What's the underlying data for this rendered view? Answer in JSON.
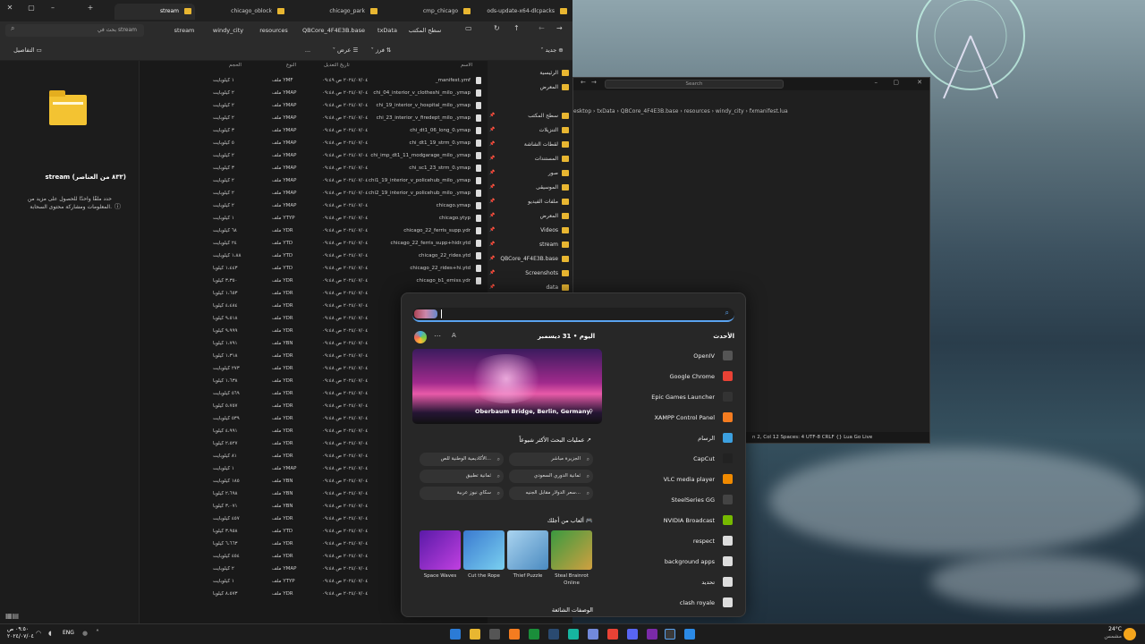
{
  "explorer": {
    "tabs": [
      {
        "label": "stream"
      },
      {
        "label": "chicago_oblock"
      },
      {
        "label": "chicago_park"
      },
      {
        "label": "cmp_chicago"
      },
      {
        "label": "ods-update-x64-dlcpacks"
      }
    ],
    "search_placeholder": "بحث في stream",
    "breadcrumbs": [
      "سطح المكتب",
      "txData",
      "QBCore_4F4E3B.base",
      "resources",
      "windy_city",
      "stream"
    ],
    "toolbar": {
      "new": "جديد",
      "sort": "فرز",
      "view": "عرض",
      "more": "...",
      "details": "التفاصيل"
    },
    "columns": {
      "name": "الاسم",
      "date": "تاريخ التعديل",
      "type": "النوع",
      "size": "الحجم"
    },
    "details_pane": {
      "title": "stream (٨٣٣ من العناصر)",
      "hint": "حدد ملفًا واحدًا للحصول على مزيد من المعلومات ومشاركة محتوى السحابة."
    },
    "nav": [
      "الرئيسية",
      "المعرض",
      "سطح المكتب",
      "التنزيلات",
      "لقطات الشاشة",
      "المستندات",
      "صور",
      "الموسيقى",
      "ملفات الفيديو",
      "المعرض",
      "Videos",
      "stream",
      "QBCore_4F4E3B.base",
      "Screenshots",
      "data"
    ],
    "files": [
      {
        "name": "_manifest.ymf",
        "date": "٢٠٢٤/٠٧/٠٤ ص ٠٩:٤٩",
        "type": "ملف YMF",
        "size": "١ كيلوبايت"
      },
      {
        "name": "chi_04_interior_v_clotheshi_milo_.ymap",
        "date": "٢٠٢٤/٠٧/٠٤ ص ٠٩:٤٨",
        "type": "ملف YMAP",
        "size": "٢ كيلوبايت"
      },
      {
        "name": "chi_19_interior_v_hospital_milo_.ymap",
        "date": "٢٠٢٤/٠٧/٠٤ ص ٠٩:٤٨",
        "type": "ملف YMAP",
        "size": "٢ كيلوبايت"
      },
      {
        "name": "chi_23_interior_v_firedept_milo_.ymap",
        "date": "٢٠٢٤/٠٧/٠٤ ص ٠٩:٤٨",
        "type": "ملف YMAP",
        "size": "٢ كيلوبايت"
      },
      {
        "name": "chi_dt1_06_long_0.ymap",
        "date": "٢٠٢٤/٠٧/٠٤ ص ٠٩:٤٨",
        "type": "ملف YMAP",
        "size": "٣ كيلوبايت"
      },
      {
        "name": "chi_dt1_19_strm_0.ymap",
        "date": "٢٠٢٤/٠٧/٠٤ ص ٠٩:٤٨",
        "type": "ملف YMAP",
        "size": "٥ كيلوبايت"
      },
      {
        "name": "chi_imp_dt1_11_modgarage_milo_.ymap",
        "date": "٢٠٢٤/٠٧/٠٤ ص ٠٩:٤٨",
        "type": "ملف YMAP",
        "size": "٢ كيلوبايت"
      },
      {
        "name": "chi_sc1_23_strm_0.ymap",
        "date": "٢٠٢٤/٠٧/٠٤ ص ٠٩:٤٨",
        "type": "ملف YMAP",
        "size": "٣ كيلوبايت"
      },
      {
        "name": "chi1_19_interior_v_policehub_milo_.ymap",
        "date": "٢٠٢٤/٠٧/٠٤ ص ٠٩:٤٨",
        "type": "ملف YMAP",
        "size": "٢ كيلوبايت"
      },
      {
        "name": "chi2_19_interior_v_policehub_milo_.ymap",
        "date": "٢٠٢٤/٠٧/٠٤ ص ٠٩:٤٨",
        "type": "ملف YMAP",
        "size": "٢ كيلوبايت"
      },
      {
        "name": "chicago.ymap",
        "date": "٢٠٢٤/٠٧/٠٤ ص ٠٩:٤٨",
        "type": "ملف YMAP",
        "size": "٢ كيلوبايت"
      },
      {
        "name": "chicago.ytyp",
        "date": "٢٠٢٤/٠٧/٠٤ ص ٠٩:٤٨",
        "type": "ملف YTYP",
        "size": "١ كيلوبايت"
      },
      {
        "name": "chicago_22_ferris_supp.ydr",
        "date": "٢٠٢٤/٠٧/٠٤ ص ٠٩:٤٨",
        "type": "ملف YDR",
        "size": "٦٨ كيلوبايت"
      },
      {
        "name": "chicago_22_ferris_supp+hidr.ytd",
        "date": "٢٠٢٤/٠٧/٠٤ ص ٠٩:٤٨",
        "type": "ملف YTD",
        "size": "٢٤ كيلوبايت"
      },
      {
        "name": "chicago_22_rides.ytd",
        "date": "٢٠٢٤/٠٧/٠٤ ص ٠٩:٤٨",
        "type": "ملف YTD",
        "size": "١،٨٨ كيلوبايت"
      },
      {
        "name": "chicago_22_rides+hi.ytd",
        "date": "٢٠٢٤/٠٧/٠٤ ص ٠٩:٤٨",
        "type": "ملف YTD",
        "size": "١،٤٤٣ كيلوبا"
      },
      {
        "name": "chicago_b1_emiss.ydr",
        "date": "٢٠٢٤/٠٧/٠٤ ص ٠٩:٤٨",
        "type": "ملف YDR",
        "size": "٣،٣٥٠ كيلوبا"
      },
      {
        "name": "",
        "date": "٢٠٢٤/٠٧/٠٤ ص ٠٩:٤٨",
        "type": "ملف YDR",
        "size": "١،٦٥٣ كيلوبا"
      },
      {
        "name": "",
        "date": "٢٠٢٤/٠٧/٠٤ ص ٠٩:٤٨",
        "type": "ملف YDR",
        "size": "٤،٤٨٤ كيلوبا"
      },
      {
        "name": "",
        "date": "٢٠٢٤/٠٧/٠٤ ص ٠٩:٤٨",
        "type": "ملف YDR",
        "size": "٩،٥١٨ كيلوبا"
      },
      {
        "name": "",
        "date": "٢٠٢٤/٠٧/٠٤ ص ٠٩:٤٨",
        "type": "ملف YDR",
        "size": "٩،٩٩٩ كيلوبا"
      },
      {
        "name": "",
        "date": "٢٠٢٤/٠٧/٠٤ ص ٠٩:٤٨",
        "type": "ملف YBN",
        "size": "١،٧٩١ كيلوبا"
      },
      {
        "name": "",
        "date": "٢٠٢٤/٠٧/٠٤ ص ٠٩:٤٨",
        "type": "ملف YDR",
        "size": "١،٣١٨ كيلوبا"
      },
      {
        "name": "",
        "date": "٢٠٢٤/٠٧/٠٤ ص ٠٩:٤٨",
        "type": "ملف YDR",
        "size": "٢٧٣ كيلوبايت"
      },
      {
        "name": "",
        "date": "٢٠٢٤/٠٧/٠٤ ص ٠٩:٤٨",
        "type": "ملف YDR",
        "size": "١،٦٣٨ كيلوبا"
      },
      {
        "name": "",
        "date": "٢٠٢٤/٠٧/٠٤ ص ٠٩:٤٨",
        "type": "ملف YDR",
        "size": "٥٦٩ كيلوبايت"
      },
      {
        "name": "",
        "date": "٢٠٢٤/٠٧/٠٤ ص ٠٩:٤٨",
        "type": "ملف YDR",
        "size": "٥،٧٥٧ كيلوبا"
      },
      {
        "name": "",
        "date": "٢٠٢٤/٠٧/٠٤ ص ٠٩:٤٨",
        "type": "ملف YDR",
        "size": "٥٣٩ كيلوبايت"
      },
      {
        "name": "",
        "date": "٢٠٢٤/٠٧/٠٤ ص ٠٩:٤٨",
        "type": "ملف YDR",
        "size": "٤،٩٩١ كيلوبا"
      },
      {
        "name": "",
        "date": "٢٠٢٤/٠٧/٠٤ ص ٠٩:٤٨",
        "type": "ملف YDR",
        "size": "٢،٥٢٧ كيلوبا"
      },
      {
        "name": "",
        "date": "٢٠٢٤/٠٧/٠٤ ص ٠٩:٤٨",
        "type": "ملف YDR",
        "size": "٨١ كيلوبايت"
      },
      {
        "name": "",
        "date": "٢٠٢٤/٠٧/٠٤ ص ٠٩:٤٨",
        "type": "ملف YMAP",
        "size": "١ كيلوبايت"
      },
      {
        "name": "",
        "date": "٢٠٢٤/٠٧/٠٤ ص ٠٩:٤٨",
        "type": "ملف YBN",
        "size": "١٨٥ كيلوبايت"
      },
      {
        "name": "",
        "date": "٢٠٢٤/٠٧/٠٤ ص ٠٩:٤٨",
        "type": "ملف YBN",
        "size": "٢،٦٩٨ كيلوبا"
      },
      {
        "name": "",
        "date": "٢٠٢٤/٠٧/٠٤ ص ٠٩:٤٨",
        "type": "ملف YBN",
        "size": "٣،٠٧١ كيلوبا"
      },
      {
        "name": "",
        "date": "٢٠٢٤/٠٧/٠٤ ص ٠٩:٤٨",
        "type": "ملف YDR",
        "size": "٤٥٧ كيلوبايت"
      },
      {
        "name": "",
        "date": "٢٠٢٤/٠٧/٠٤ ص ٠٩:٤٨",
        "type": "ملف YTD",
        "size": "٣،٩٥٨ كيلوبا"
      },
      {
        "name": "",
        "date": "٢٠٢٤/٠٧/٠٤ ص ٠٩:٤٨",
        "type": "ملف YDR",
        "size": "٦،٦٦٣ كيلوبا"
      },
      {
        "name": "",
        "date": "٢٠٢٤/٠٧/٠٤ ص ٠٩:٤٨",
        "type": "ملف YDR",
        "size": "٤٥٤ كيلوبايت"
      },
      {
        "name": "",
        "date": "٢٠٢٤/٠٧/٠٤ ص ٠٩:٤٨",
        "type": "ملف YMAP",
        "size": "٢ كيلوبايت"
      },
      {
        "name": "",
        "date": "٢٠٢٤/٠٧/٠٤ ص ٠٩:٤٨",
        "type": "ملف YTYP",
        "size": "١ كيلوبايت"
      },
      {
        "name": "",
        "date": "٢٠٢٤/٠٧/٠٤ ص ٠٩:٤٨",
        "type": "ملف YDR",
        "size": "٨،٥٧٣ كيلوبا"
      }
    ]
  },
  "code": {
    "search": "Search",
    "path": "esktop › txData › QBCore_4F4E3B.base › resources › windy_city › fxmanifest.lua",
    "status": "n 2, Col 12    Spaces: 4    UTF-8    CRLF    {} Lua    Go Live"
  },
  "start": {
    "date": "اليوم • 31 ديسمبر",
    "recent_title": "الأحدث",
    "hero_caption": "Oberbaum Bridge, Berlin, Germany",
    "trending_title": "عمليات البحث الأكثر شيوعاً",
    "chips": [
      "الجزيرة مباشر",
      "الأكاديمية الوطنية للص...",
      "ثمانية الدوري السعودي",
      "ثمانية تطبيق",
      "سعر الدولار مقابل الجنيه...",
      "سكاي نيوز عربية"
    ],
    "games_title": "ألعاب من أجلك",
    "games": [
      "Space Waves",
      "Cut the Rope",
      "Thief Puzzle",
      "Steal Brainrot Online"
    ],
    "footer_title": "الوصفات الشائعة",
    "apps": [
      {
        "name": "OpenIV",
        "color": "#555"
      },
      {
        "name": "Google Chrome",
        "color": "#e94235"
      },
      {
        "name": "Epic Games Launcher",
        "color": "#333"
      },
      {
        "name": "XAMPP Control Panel",
        "color": "#f47c20"
      },
      {
        "name": "الرسام",
        "color": "#3ca0e0"
      },
      {
        "name": "CapCut",
        "color": "#222"
      },
      {
        "name": "VLC media player",
        "color": "#f08a00"
      },
      {
        "name": "SteelSeries GG",
        "color": "#444"
      },
      {
        "name": "NVIDIA Broadcast",
        "color": "#76b900"
      },
      {
        "name": "respect",
        "color": "#ddd"
      },
      {
        "name": "background apps",
        "color": "#ddd"
      },
      {
        "name": "تحديد",
        "color": "#ddd"
      },
      {
        "name": "clash royale",
        "color": "#ddd"
      }
    ]
  },
  "taskbar": {
    "time": "٠٩:٥٠ ص",
    "date": "٢٠٢٤/٠٧/٠٤",
    "lang": "ENG",
    "weather": "24°C",
    "weather_desc": "مشمس"
  }
}
